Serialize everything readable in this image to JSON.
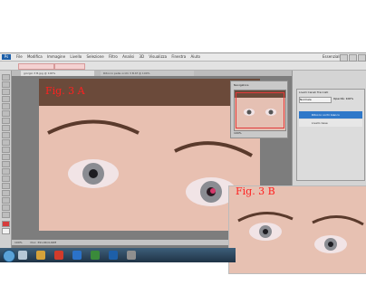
{
  "figures": {
    "fig_a_label": "Fig. 3 A",
    "fig_b_label": "Fig. 3 B"
  },
  "menubar": {
    "logo": "Ps",
    "items": [
      "File",
      "Modifica",
      "Immagine",
      "Livello",
      "Selezione",
      "Filtro",
      "Analisi",
      "3D",
      "Visualizza",
      "Finestra",
      "Aiuto"
    ],
    "workspace": "Essenziali"
  },
  "doc_tabs": {
    "active": "giorgio 3 B.jpg @ 100%",
    "inactive": "Ritocco pelle occhi 3 B.tif @ 100%"
  },
  "status": {
    "zoom": "100%",
    "doc": "Doc: 391,6K/4,02M"
  },
  "nav_panel": {
    "title": "Navigatore",
    "zoom": "100%"
  },
  "layers_panel": {
    "tabs": [
      "Livelli",
      "Canali",
      "Tracciati"
    ],
    "blend": "Normale",
    "opacity": "Opacità: 100%",
    "layers": [
      "Ritocco occhi bianco",
      "Livello base"
    ]
  },
  "colors": {
    "label_red": "#ff2020",
    "accent": "#2f78c9"
  }
}
